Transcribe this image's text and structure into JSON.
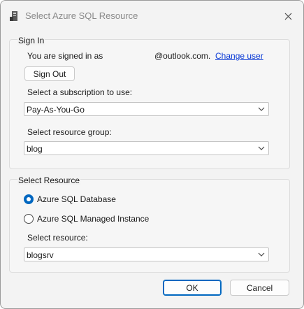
{
  "window": {
    "title": "Select Azure SQL Resource"
  },
  "signin": {
    "group_title": "Sign In",
    "signed_in_text": "You are signed in as",
    "account_suffix": "@outlook.com.",
    "change_user": "Change user",
    "sign_out": "Sign Out",
    "subscription_label": "Select a subscription to use:",
    "subscription_value": "Pay-As-You-Go",
    "resource_group_label": "Select resource group:",
    "resource_group_value": "blog"
  },
  "resource": {
    "group_title": "Select Resource",
    "options": [
      {
        "label": "Azure SQL Database",
        "checked": true
      },
      {
        "label": "Azure SQL Managed Instance",
        "checked": false
      }
    ],
    "resource_label": "Select resource:",
    "resource_value": "blogsrv"
  },
  "footer": {
    "ok": "OK",
    "cancel": "Cancel"
  },
  "colors": {
    "accent": "#0067c0",
    "link": "#0b3bd6"
  }
}
